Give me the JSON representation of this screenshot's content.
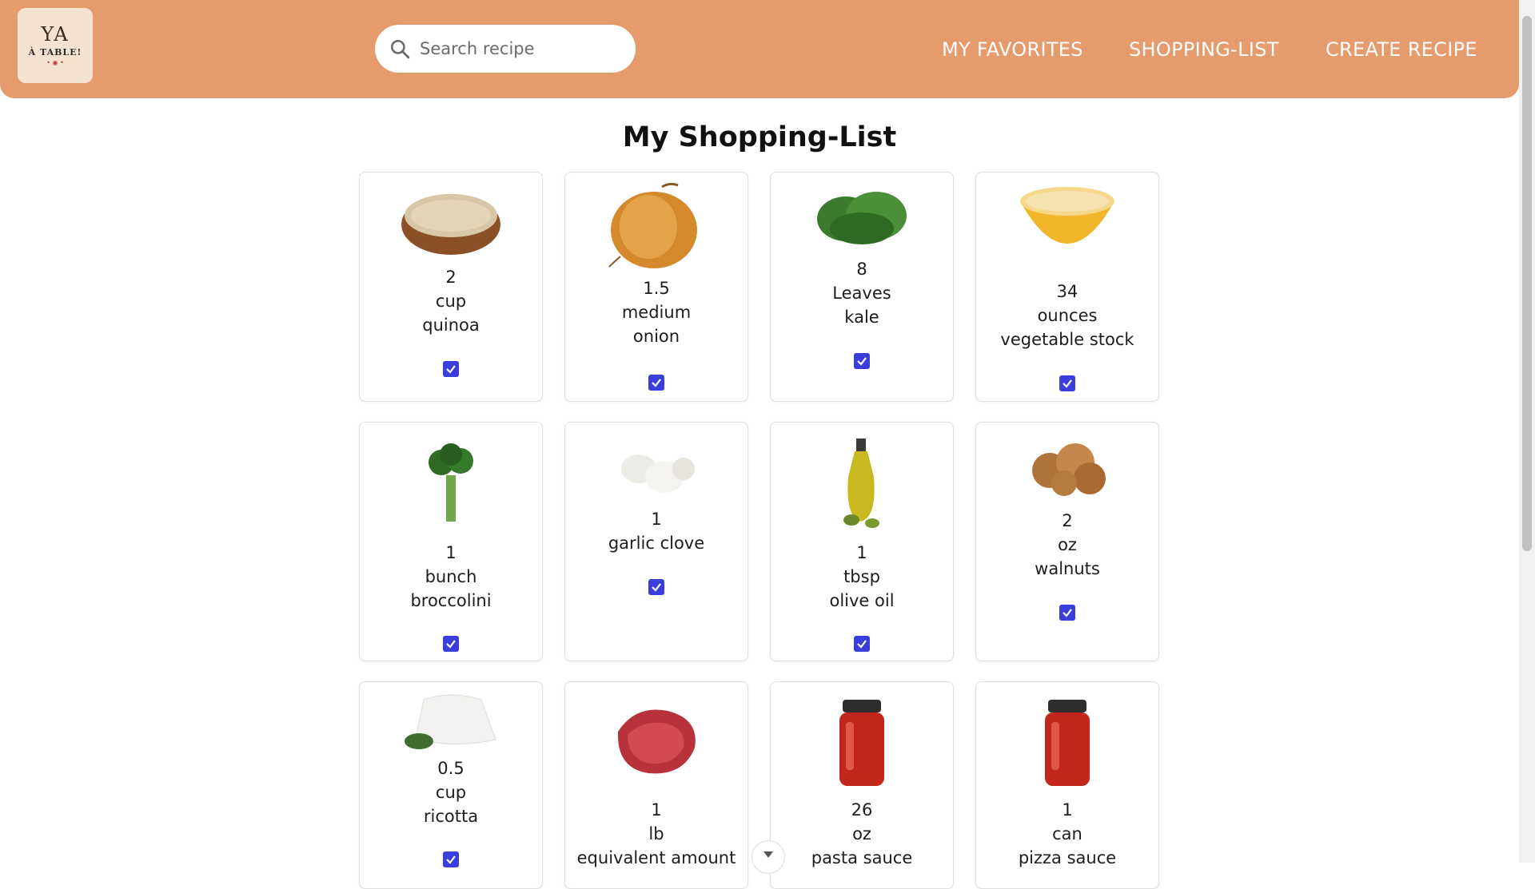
{
  "header": {
    "logo_mark": "YA",
    "logo_text": "À TABLE!",
    "logo_dots": "• ◉ •",
    "search_placeholder": "Search recipe",
    "nav": [
      "MY FAVORITES",
      "SHOPPING-LIST",
      "CREATE RECIPE"
    ]
  },
  "page_title": "My Shopping-List",
  "items": [
    {
      "qty": "2",
      "unit": "cup",
      "name": "quinoa",
      "checked": true,
      "icon": "quinoa-bowl-icon"
    },
    {
      "qty": "1.5",
      "unit": "medium",
      "name": "onion",
      "checked": true,
      "icon": "onion-icon"
    },
    {
      "qty": "8",
      "unit": "Leaves",
      "name": "kale",
      "checked": true,
      "icon": "kale-icon"
    },
    {
      "qty": "34",
      "unit": "ounces",
      "name": "vegetable stock",
      "checked": true,
      "icon": "stock-bowl-icon"
    },
    {
      "qty": "1",
      "unit": "bunch",
      "name": "broccolini",
      "checked": true,
      "icon": "broccolini-icon"
    },
    {
      "qty": "1",
      "unit": "",
      "name": "garlic clove",
      "checked": true,
      "icon": "garlic-icon"
    },
    {
      "qty": "1",
      "unit": "tbsp",
      "name": "olive oil",
      "checked": true,
      "icon": "olive-oil-icon"
    },
    {
      "qty": "2",
      "unit": "oz",
      "name": "walnuts",
      "checked": true,
      "icon": "walnuts-icon"
    },
    {
      "qty": "0.5",
      "unit": "cup",
      "name": "ricotta",
      "checked": true,
      "icon": "ricotta-icon"
    },
    {
      "qty": "1",
      "unit": "lb",
      "name": "equivalent amount",
      "checked": true,
      "icon": "ground-meat-icon"
    },
    {
      "qty": "26",
      "unit": "oz",
      "name": "pasta sauce",
      "checked": true,
      "icon": "sauce-jar-icon"
    },
    {
      "qty": "1",
      "unit": "can",
      "name": "pizza sauce",
      "checked": true,
      "icon": "sauce-jar-icon"
    }
  ],
  "colors": {
    "header": "#e59b6b",
    "checkbox": "#3a3fdc"
  }
}
